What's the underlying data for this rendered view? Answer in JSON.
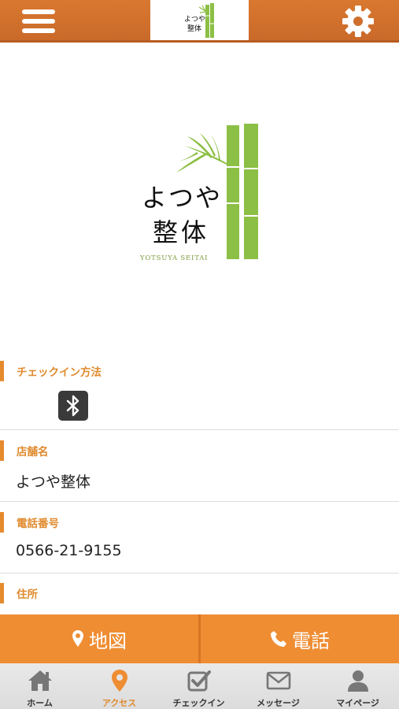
{
  "header": {
    "logo_text_line1": "よつや",
    "logo_text_line2": "整体"
  },
  "hero": {
    "logo_jp_line1": "よつや",
    "logo_jp_line2": "整体",
    "logo_en": "YOTSUYA SEITAI"
  },
  "sections": {
    "checkin_method": {
      "label": "チェックイン方法"
    },
    "store_name": {
      "label": "店舗名",
      "value": "よつや整体"
    },
    "phone": {
      "label": "電話番号",
      "value": "0566-21-9155"
    },
    "address": {
      "label": "住所"
    }
  },
  "actions": {
    "map_label": "地図",
    "tel_label": "電話"
  },
  "tabs": [
    {
      "label": "ホーム",
      "icon": "home-icon"
    },
    {
      "label": "アクセス",
      "icon": "map-pin-icon",
      "active": true
    },
    {
      "label": "チェックイン",
      "icon": "checkin-icon"
    },
    {
      "label": "メッセージ",
      "icon": "envelope-icon"
    },
    {
      "label": "マイページ",
      "icon": "user-icon"
    }
  ],
  "colors": {
    "header": "#d9782f",
    "accent": "#e08a2d",
    "action_bar": "#ef8d33",
    "bamboo": "#8cbf45"
  }
}
